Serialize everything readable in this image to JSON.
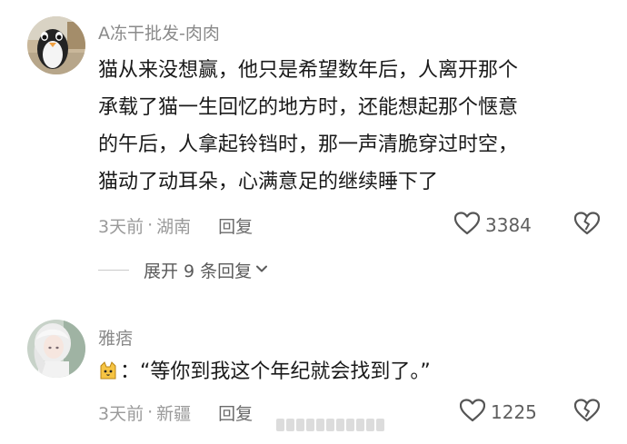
{
  "comments": [
    {
      "username": "A冻干批发-肉肉",
      "avatar_icon": "penguin-avatar",
      "lines": [
        "猫从来没想赢，他只是希望数年后，人离开那个",
        "承载了猫一生回忆的地方时，还能想起那个惬意",
        "的午后，人拿起铃铛时，那一声清脆穿过时空，",
        "猫动了动耳朵，心满意足的继续睡下了"
      ],
      "time": "3天前",
      "separator": "·",
      "location": "湖南",
      "reply_label": "回复",
      "like_count": "3384",
      "expand_label": "展开 9 条回复"
    },
    {
      "username": "雅痞",
      "avatar_icon": "anime-girl-avatar",
      "emoji": "cat-face",
      "text": "：“等你到我这个年纪就会找到了。”",
      "time": "3天前",
      "separator": "·",
      "location": "新疆",
      "reply_label": "回复",
      "like_count": "1225"
    }
  ],
  "colors": {
    "username": "#8a8a8a",
    "body_text": "#1a1a1a",
    "meta": "#9a9a9a",
    "icon": "#555555"
  },
  "icons": [
    "heart-outline-icon",
    "broken-heart-icon",
    "chevron-down-icon",
    "cat-emoji-icon"
  ]
}
